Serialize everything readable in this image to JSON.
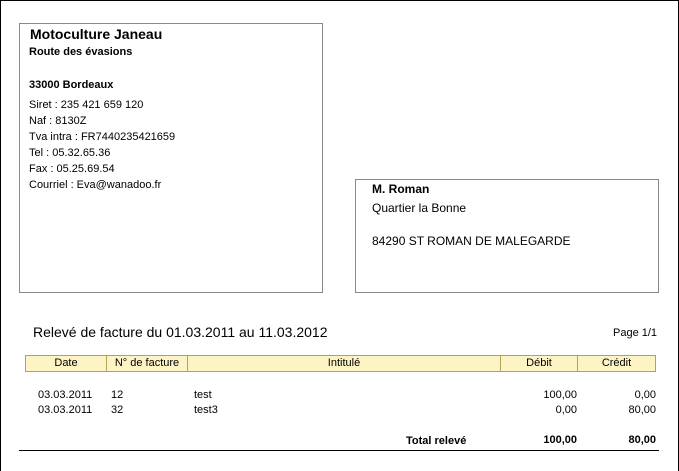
{
  "sender": {
    "name": "Motoculture Janeau",
    "street": "Route des évasions",
    "city": "33000  Bordeaux",
    "siret": "Siret : 235 421 659 120",
    "naf": "Naf : 8130Z",
    "tva": "Tva intra : FR7440235421659",
    "tel": "Tel : 05.32.65.36",
    "fax": "Fax : 05.25.69.54",
    "email": "Courriel : Eva@wanadoo.fr"
  },
  "recipient": {
    "name": "M. Roman",
    "street": "Quartier la Bonne",
    "city": "84290  ST ROMAN DE MALEGARDE"
  },
  "statement": {
    "title": "Relevé de facture du 01.03.2011 au 11.03.2012",
    "page": "Page 1/1"
  },
  "table": {
    "headers": {
      "date": "Date",
      "invoice_no": "N° de facture",
      "label": "Intitulé",
      "debit": "Débit",
      "credit": "Crédit"
    },
    "rows": [
      {
        "date": "03.03.2011",
        "invoice_no": "12",
        "label": "test",
        "debit": "100,00",
        "credit": "0,00"
      },
      {
        "date": "03.03.2011",
        "invoice_no": "32",
        "label": "test3",
        "debit": "0,00",
        "credit": "80,00"
      }
    ],
    "total": {
      "label": "Total relevé",
      "debit": "100,00",
      "credit": "80,00"
    }
  }
}
